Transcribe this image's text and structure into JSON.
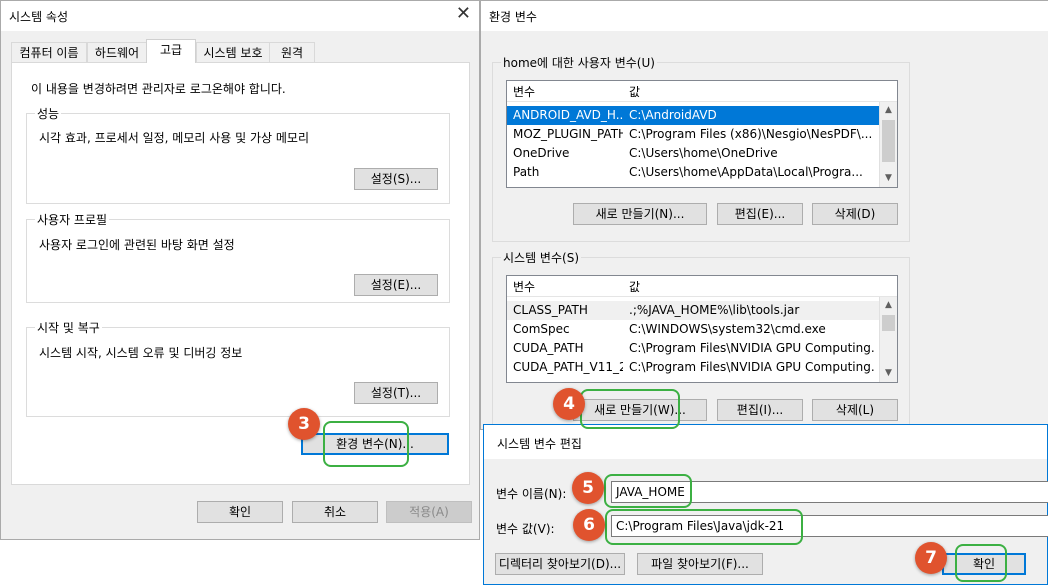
{
  "left_window": {
    "title": "시스템 속성",
    "tabs": [
      "컴퓨터 이름",
      "하드웨어",
      "고급",
      "시스템 보호",
      "원격"
    ],
    "admin_note": "이 내용을 변경하려면 관리자로 로그온해야 합니다.",
    "performance": {
      "title": "성능",
      "desc": "시각 효과, 프로세서 일정, 메모리 사용 및 가상 메모리",
      "button": "설정(S)..."
    },
    "profile": {
      "title": "사용자 프로필",
      "desc": "사용자 로그인에 관련된 바탕 화면 설정",
      "button": "설정(E)..."
    },
    "startup": {
      "title": "시작 및 복구",
      "desc": "시스템 시작, 시스템 오류 및 디버깅 정보",
      "button": "설정(T)..."
    },
    "env_button": "환경 변수(N)...",
    "ok": "확인",
    "cancel": "취소",
    "apply": "적용(A)"
  },
  "right_window": {
    "title": "환경 변수",
    "user_group": "home에 대한 사용자 변수(U)",
    "col_var": "변수",
    "col_val": "값",
    "user_vars": [
      {
        "name": "ANDROID_AVD_H...",
        "value": "C:\\AndroidAVD",
        "selected": true
      },
      {
        "name": "MOZ_PLUGIN_PATH",
        "value": "C:\\Program Files (x86)\\Nesgio\\NesPDF\\..."
      },
      {
        "name": "OneDrive",
        "value": "C:\\Users\\home\\OneDrive"
      },
      {
        "name": "Path",
        "value": "C:\\Users\\home\\AppData\\Local\\Progra..."
      }
    ],
    "user_buttons": [
      "새로 만들기(N)...",
      "편집(E)...",
      "삭제(D)"
    ],
    "system_group": "시스템 변수(S)",
    "system_vars": [
      {
        "name": "CLASS_PATH",
        "value": ".;%JAVA_HOME%\\lib\\tools.jar"
      },
      {
        "name": "ComSpec",
        "value": "C:\\WINDOWS\\system32\\cmd.exe"
      },
      {
        "name": "CUDA_PATH",
        "value": "C:\\Program Files\\NVIDIA GPU Computing..."
      },
      {
        "name": "CUDA_PATH_V11_2",
        "value": "C:\\Program Files\\NVIDIA GPU Computing..."
      }
    ],
    "system_buttons": [
      "새로 만들기(W)...",
      "편집(I)...",
      "삭제(L)"
    ]
  },
  "edit_dialog": {
    "title": "시스템 변수 편집",
    "name_label": "변수 이름(N):",
    "name_value": "JAVA_HOME",
    "value_label": "변수 값(V):",
    "value_value": "C:\\Program Files\\Java\\jdk-21",
    "browse_dir": "디렉터리 찾아보기(D)...",
    "browse_file": "파일 찾아보기(F)...",
    "ok": "확인"
  },
  "callouts": [
    "3",
    "4",
    "5",
    "6",
    "7"
  ],
  "colors": {
    "accent": "#0078d7",
    "callout": "#e0532e",
    "highlight": "#3cb043"
  }
}
